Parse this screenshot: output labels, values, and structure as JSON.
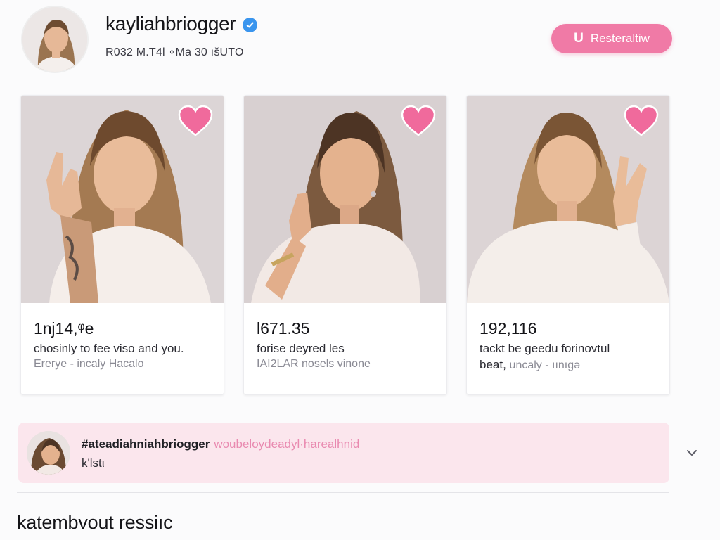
{
  "profile": {
    "username": "kayliahbriogger",
    "meta": "R032 M.T4l ∘Ma 30 ıšUTO",
    "cta": {
      "icon": "U",
      "label": "Resteraltiw"
    },
    "verified_icon": "verified-badge-icon"
  },
  "posts": [
    {
      "count": "1ǌ14,ᵠе",
      "caption": "chosinly to fee viso and you.",
      "sub": "Ererye - incaly Hacalo"
    },
    {
      "count": "l671.35",
      "caption": "forise deyred les",
      "sub": "IAI2LAR nosels vinone"
    },
    {
      "count": "192,116",
      "caption": "tackt be geedu forinovtul",
      "caption_2": "beat,",
      "sub": "uncaly - ıınıgə"
    }
  ],
  "comment": {
    "handle": "#ateadiahniahbriogger",
    "link": "woubeloydeadyl·harealhnid",
    "text": "k'lstι"
  },
  "section_title": "katembvout ressiıc",
  "colors": {
    "accent_pink": "#f07aa6",
    "heart_pink": "#f06a9c",
    "verified_blue": "#3a95ee",
    "comment_bg": "#fbe6ed"
  }
}
